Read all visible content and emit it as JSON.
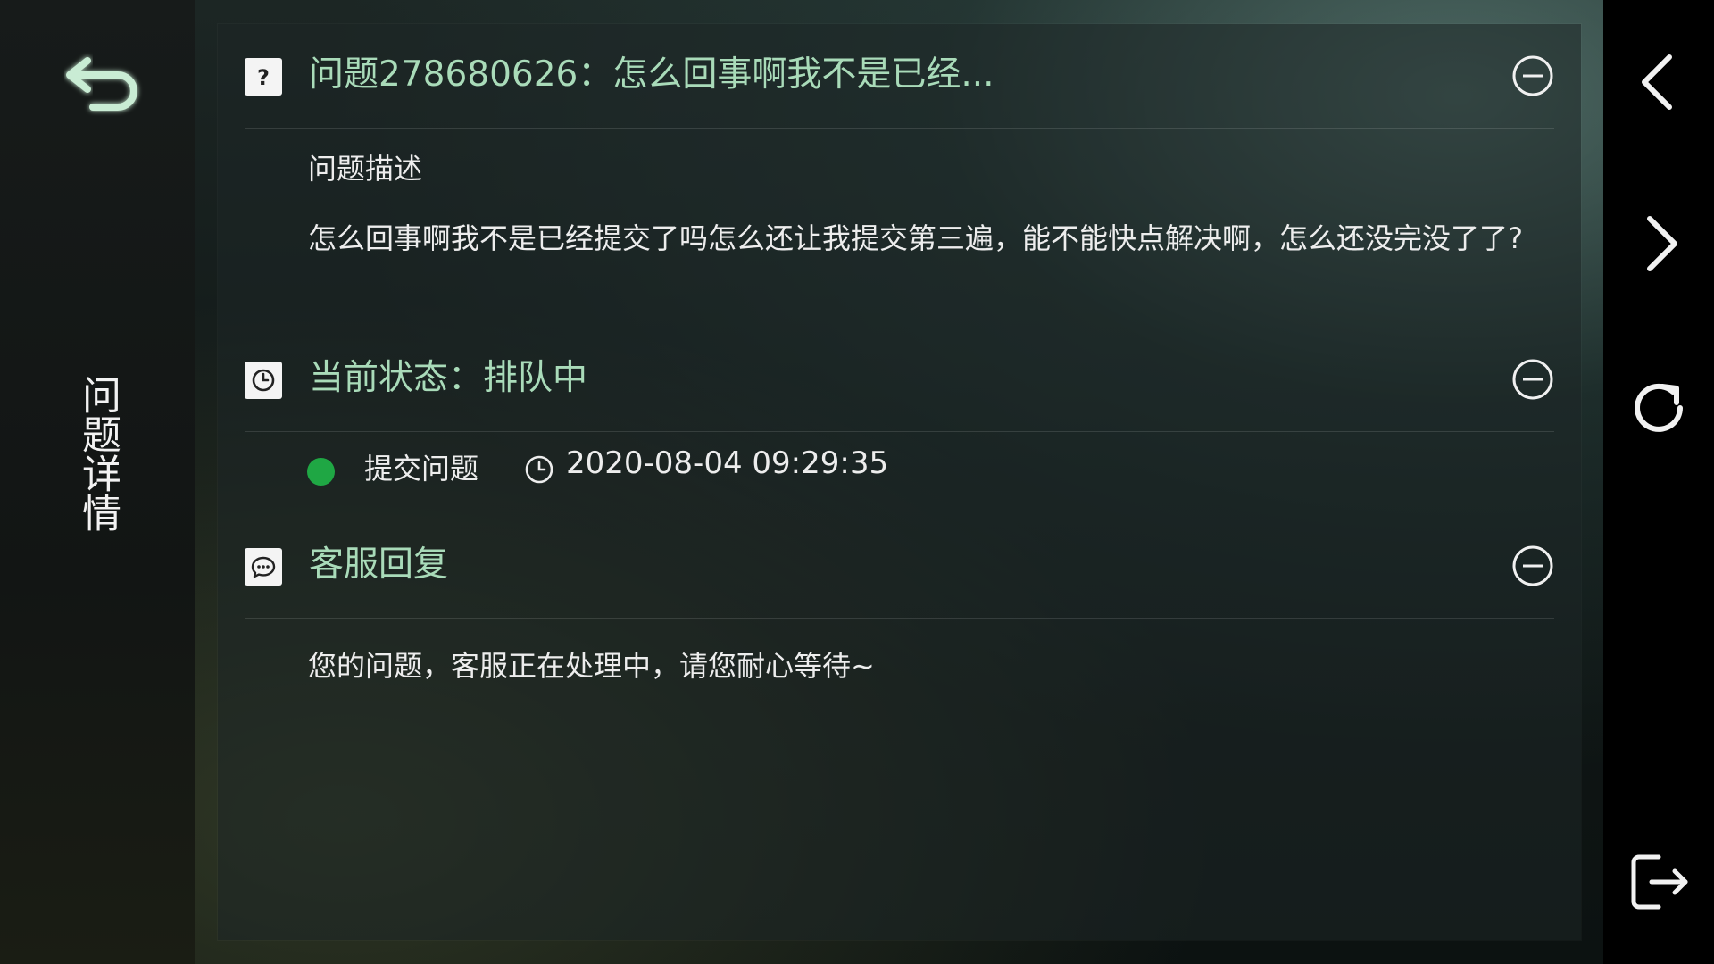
{
  "sidebar": {
    "vertical_title": "问题详情",
    "back_icon": "back-arrow-icon"
  },
  "question": {
    "icon": "question-mark-icon",
    "title": "问题278680626：怎么回事啊我不是已经...",
    "description_label": "问题描述",
    "description": "怎么回事啊我不是已经提交了吗怎么还让我提交第三遍，能不能快点解决啊，怎么还没完没了了?",
    "collapse_icon": "collapse-minus-icon"
  },
  "status": {
    "icon": "clock-icon",
    "title": "当前状态：排队中",
    "step_label": "提交问题",
    "step_time": "2020-08-04 09:29:35",
    "step_dot_color": "#1fa744",
    "collapse_icon": "collapse-minus-icon"
  },
  "reply": {
    "icon": "chat-bubble-icon",
    "title": "客服回复",
    "text": "您的问题，客服正在处理中，请您耐心等待~",
    "collapse_icon": "collapse-minus-icon"
  },
  "nav": {
    "back_icon": "chevron-left-icon",
    "forward_icon": "chevron-right-icon",
    "refresh_icon": "refresh-icon",
    "exit_icon": "exit-icon"
  },
  "colors": {
    "accent_green_text": "#a9dbb9",
    "status_dot": "#1fa744",
    "body_text": "#ededed"
  }
}
